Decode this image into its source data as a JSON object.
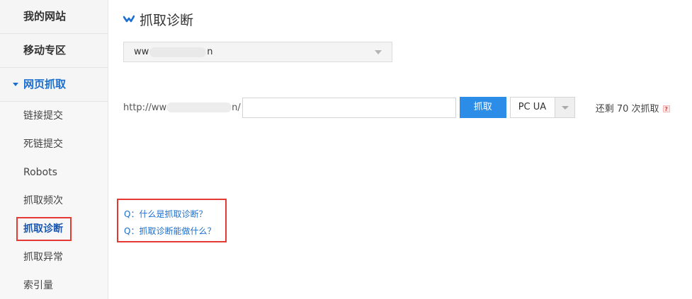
{
  "sidebar": {
    "sections": [
      {
        "label": "我的网站"
      },
      {
        "label": "移动专区"
      },
      {
        "label": "网页抓取"
      }
    ],
    "items": [
      {
        "label": "链接提交"
      },
      {
        "label": "死链提交"
      },
      {
        "label": "Robots"
      },
      {
        "label": "抓取频次"
      },
      {
        "label": "抓取诊断"
      },
      {
        "label": "抓取异常"
      },
      {
        "label": "索引量"
      }
    ]
  },
  "main": {
    "title": "抓取诊断",
    "site_select": {
      "prefix": "ww",
      "suffix": "n"
    },
    "url_prefix": {
      "start": "http://ww",
      "end": "n/"
    },
    "url_input": {
      "value": "",
      "placeholder": ""
    },
    "fetch_button": "抓取",
    "ua_select": "PC UA",
    "remaining": "还剩 70 次抓取",
    "help_glyph": "?",
    "faq": [
      {
        "label": "Q：什么是抓取诊断？"
      },
      {
        "label": "Q：抓取诊断能做什么？"
      }
    ]
  },
  "colors": {
    "accent": "#2b8de8",
    "link": "#1a6fd0",
    "highlight": "#e53935"
  },
  "icons": {
    "title_logo": "check-chevron-icon",
    "dropdown": "chevron-down-icon",
    "section_caret": "caret-down-icon",
    "help": "question-icon"
  }
}
